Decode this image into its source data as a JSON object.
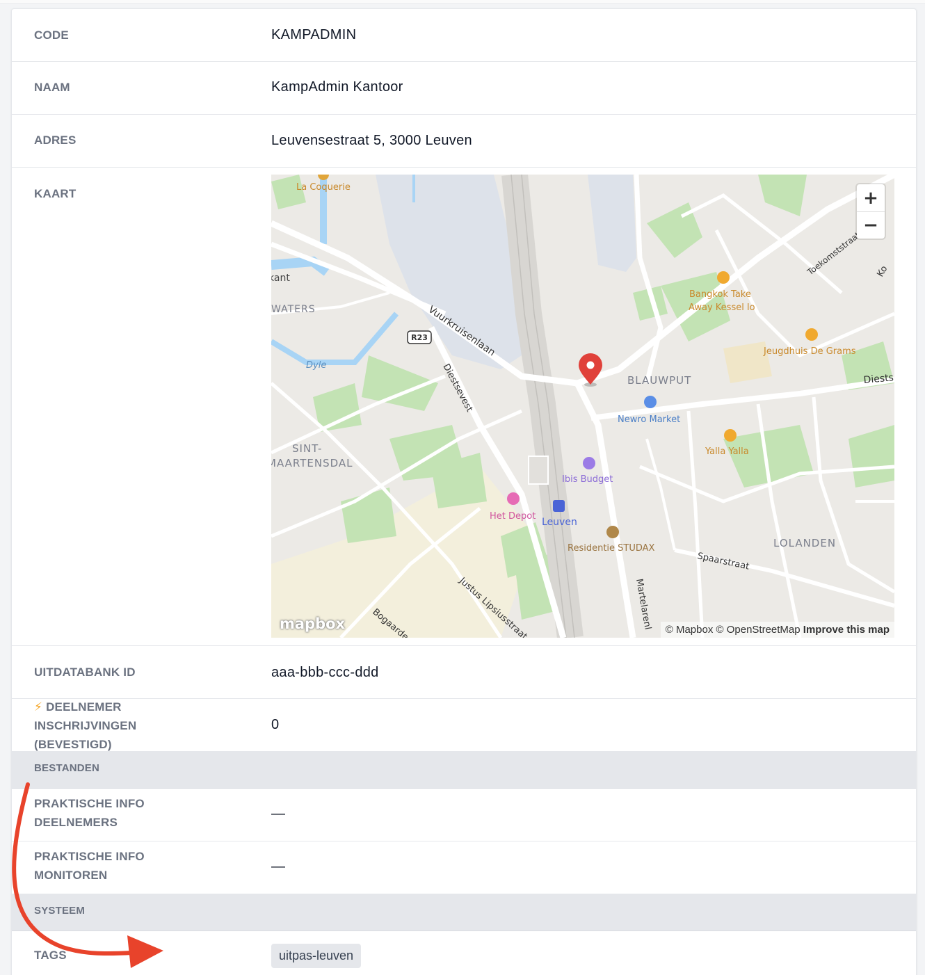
{
  "fields": {
    "code": {
      "label": "CODE",
      "value": "KAMPADMIN"
    },
    "naam": {
      "label": "NAAM",
      "value": "KampAdmin Kantoor"
    },
    "adres": {
      "label": "ADRES",
      "value": "Leuvensestraat 5, 3000 Leuven"
    },
    "kaart": {
      "label": "KAART"
    },
    "uitdatabank": {
      "label": "UITDATABANK ID",
      "value": "aaa-bbb-ccc-ddd"
    },
    "deelnemers": {
      "icon": "lightning-icon",
      "icon_glyph": "⚡",
      "label_line1": "DEELNEMER",
      "label_line2": "INSCHRIJVINGEN",
      "label_line3": "(BEVESTIGD)",
      "value": "0"
    },
    "praktisch_deelnemers": {
      "label_line1": "PRAKTISCHE INFO",
      "label_line2": "DEELNEMERS",
      "value": "—"
    },
    "praktisch_monitoren": {
      "label_line1": "PRAKTISCHE INFO",
      "label_line2": "MONITOREN",
      "value": "—"
    },
    "tags": {
      "label": "TAGS",
      "items": [
        "uitpas-leuven"
      ]
    }
  },
  "sections": {
    "bestanden": "BESTANDEN",
    "systeem": "SYSTEEM"
  },
  "map": {
    "zoom_in": "+",
    "zoom_out": "−",
    "logo": "mapbox",
    "attribution_1": "© Mapbox © OpenStreetMap",
    "attribution_2": "Improve this map",
    "labels": {
      "la_coquerie": "La Coquerie",
      "kant": "kant",
      "waters": "WATERS",
      "dyle": "Dyle",
      "r23": "R23",
      "vuurkruisenlaan": "Vuurkruisenlaan",
      "diestsevest": "Diestsevest",
      "sint": "SINT-",
      "maartensdal": "MAARTENSDAL",
      "het_depot": "Het Depot",
      "leuven": "Leuven",
      "ibis": "Ibis Budget",
      "residentie": "Residentie STUDAX",
      "blauwput": "BLAUWPUT",
      "newro": "Newro Market",
      "yalla": "Yalla Yalla",
      "bangkok1": "Bangkok Take",
      "bangkok2": "Away Kessel lo",
      "jeugdhuis": "Jeugdhuis De Grams",
      "toekomst": "Toekomststraat",
      "diests": "Diests",
      "lolanden": "LOLANDEN",
      "spaarstraat": "Spaarstraat",
      "justus": "Justus Lipsiusstraat",
      "martelare": "Martelarenl",
      "bogaarden": "Bogaarde",
      "ko": "Ko"
    },
    "colors": {
      "water": "#a8d4f5",
      "park": "#c3e3b4",
      "land": "#eceae6",
      "road": "#ffffff",
      "pin": "#e0413a"
    }
  },
  "annotation": {
    "arrow_color": "#e8432b"
  }
}
